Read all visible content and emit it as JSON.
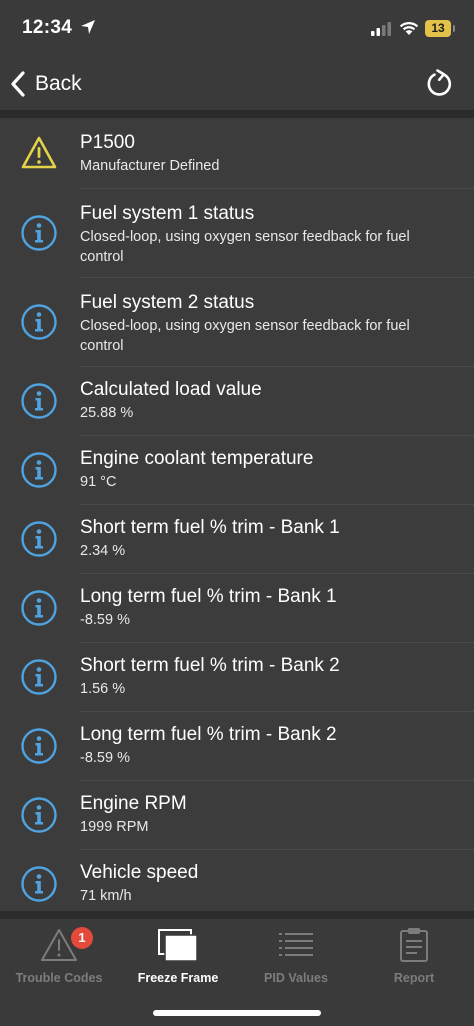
{
  "status_bar": {
    "time": "12:34",
    "battery_level": "13",
    "battery_color": "#e3c24a"
  },
  "nav": {
    "back_label": "Back",
    "back_icon": "chevron-left-icon",
    "refresh_icon": "refresh-icon"
  },
  "items": [
    {
      "icon": "warning-icon",
      "title": "P1500",
      "subtitle": "Manufacturer Defined"
    },
    {
      "icon": "info-icon",
      "title": "Fuel system 1 status",
      "subtitle": "Closed-loop, using oxygen sensor feedback for fuel control"
    },
    {
      "icon": "info-icon",
      "title": "Fuel system 2 status",
      "subtitle": "Closed-loop, using oxygen sensor feedback for fuel control"
    },
    {
      "icon": "info-icon",
      "title": "Calculated load value",
      "subtitle": "25.88 %"
    },
    {
      "icon": "info-icon",
      "title": "Engine coolant temperature",
      "subtitle": "91 °C"
    },
    {
      "icon": "info-icon",
      "title": "Short term fuel % trim - Bank 1",
      "subtitle": "2.34 %"
    },
    {
      "icon": "info-icon",
      "title": "Long term fuel % trim - Bank 1",
      "subtitle": "-8.59 %"
    },
    {
      "icon": "info-icon",
      "title": "Short term fuel % trim - Bank 2",
      "subtitle": "1.56 %"
    },
    {
      "icon": "info-icon",
      "title": "Long term fuel % trim - Bank 2",
      "subtitle": "-8.59 %"
    },
    {
      "icon": "info-icon",
      "title": "Engine RPM",
      "subtitle": "1999 RPM"
    },
    {
      "icon": "info-icon",
      "title": "Vehicle speed",
      "subtitle": "71 km/h"
    }
  ],
  "tabs": [
    {
      "label": "Trouble Codes",
      "icon": "warning-outline-icon",
      "badge": "1",
      "active": false
    },
    {
      "label": "Freeze Frame",
      "icon": "stacked-frames-icon",
      "active": true
    },
    {
      "label": "PID Values",
      "icon": "list-icon",
      "active": false
    },
    {
      "label": "Report",
      "icon": "clipboard-icon",
      "active": false
    }
  ],
  "colors": {
    "background": "#3c3c3c",
    "bar_background": "#3a3a3a",
    "divider": "#2b2b2b",
    "info_icon_blue": "#4fa3e0",
    "warning_yellow": "#e4d349",
    "badge_red": "#e34a3c",
    "inactive_tab": "#7c7c7c"
  }
}
